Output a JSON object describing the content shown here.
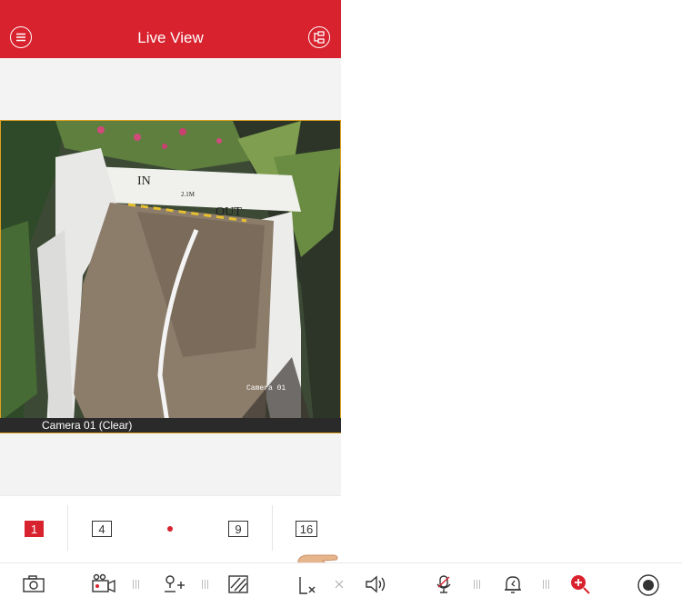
{
  "header": {
    "title": "Live View",
    "menu_icon": "menu-icon",
    "device_icon": "device-list-icon",
    "color": "#d8222e"
  },
  "video": {
    "caption": "Camera 01 (Clear)",
    "osd_label": "Camera 01"
  },
  "window_split": {
    "options": [
      "1",
      "4",
      "9",
      "16"
    ],
    "selected": "1"
  },
  "toolbar": {
    "icons": [
      "snapshot-icon",
      "record-icon",
      "ptz-icon",
      "quality-icon",
      "stop-all-icon",
      "audio-icon",
      "talk-icon",
      "alarm-icon",
      "zoom-icon",
      "fisheye-icon"
    ]
  }
}
